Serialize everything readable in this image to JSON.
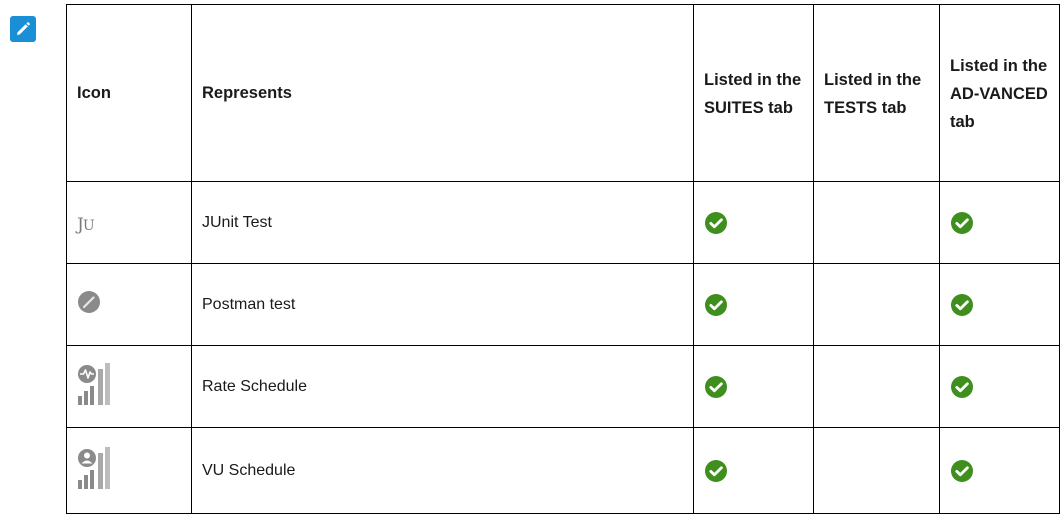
{
  "colors": {
    "note_icon_bg": "#1b8fd6",
    "check_green": "#3f8f1e",
    "icon_gray": "#8a8a8a",
    "border": "#000000"
  },
  "table": {
    "headers": {
      "icon": "Icon",
      "represents": "Represents",
      "suites": "Listed in the SUITES tab",
      "tests": "Listed in the TESTS tab",
      "advanced": "Listed in the AD-VANCED tab"
    },
    "rows": [
      {
        "icon": "junit-test-icon",
        "icon_text": "JU",
        "represents": "JUnit Test",
        "suites": true,
        "tests": false,
        "advanced": true
      },
      {
        "icon": "postman-test-icon",
        "represents": "Postman test",
        "suites": true,
        "tests": false,
        "advanced": true
      },
      {
        "icon": "rate-schedule-icon",
        "represents": "Rate Schedule",
        "suites": true,
        "tests": false,
        "advanced": true
      },
      {
        "icon": "vu-schedule-icon",
        "represents": "VU Schedule",
        "suites": true,
        "tests": false,
        "advanced": true
      }
    ]
  }
}
